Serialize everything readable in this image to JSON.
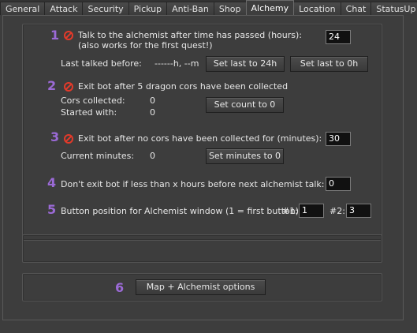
{
  "tabs": [
    {
      "label": "General",
      "active": false
    },
    {
      "label": "Attack",
      "active": false
    },
    {
      "label": "Security",
      "active": false
    },
    {
      "label": "Pickup",
      "active": false
    },
    {
      "label": "Anti-Ban",
      "active": false
    },
    {
      "label": "Shop",
      "active": false
    },
    {
      "label": "Alchemy",
      "active": true
    },
    {
      "label": "Location",
      "active": false
    },
    {
      "label": "Chat",
      "active": false
    },
    {
      "label": "StatusUp",
      "active": false
    }
  ],
  "accent_color": "#9b6ad6",
  "stop_icon_color": "#e23a2a",
  "sections": {
    "s1": {
      "number": "1",
      "icon": "stop-icon",
      "label_line1": "Talk to the alchemist after time has passed (hours):",
      "label_line2": "(also works for the first quest!)",
      "hours_value": "24",
      "last_talked_label": "Last talked before:",
      "last_talked_value": "------h, --m",
      "set_last_24h_button": "Set last to 24h",
      "set_last_0h_button": "Set last to 0h"
    },
    "s2": {
      "number": "2",
      "icon": "stop-icon",
      "label": "Exit bot after 5 dragon cors have been collected",
      "cors_collected_label": "Cors collected:",
      "cors_collected_value": "0",
      "started_with_label": "Started with:",
      "started_with_value": "0",
      "set_count_button": "Set count to 0"
    },
    "s3": {
      "number": "3",
      "icon": "stop-icon",
      "label": "Exit bot after no cors have been collected for (minutes):",
      "minutes_value": "30",
      "current_minutes_label": "Current minutes:",
      "current_minutes_value": "0",
      "set_minutes_button": "Set minutes to 0"
    },
    "s4": {
      "number": "4",
      "label": "Don't exit bot if less than x hours before next alchemist talk:",
      "hours_value": "0"
    },
    "s5": {
      "number": "5",
      "label": "Button position for Alchemist window (1 = first button):",
      "field1_label": "#1:",
      "field1_value": "1",
      "field2_label": "#2:",
      "field2_value": "3"
    },
    "s6": {
      "number": "6",
      "map_options_button": "Map + Alchemist options"
    }
  }
}
